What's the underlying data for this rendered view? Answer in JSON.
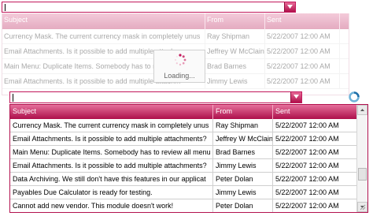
{
  "colors": {
    "accent": "#b3124f",
    "accent_light": "#e56f9b"
  },
  "top_grid": {
    "columns": [
      "Subject",
      "From",
      "Sent"
    ],
    "rows": [
      [
        "Currency Mask. The current currency mask in completely unus",
        "Ray Shipman",
        "5/22/2007 12:00 AM"
      ],
      [
        "Email Attachments. Is it possible to add multiple attachme",
        "Jeffrey W McClain",
        "5/22/2007 12:00 AM"
      ],
      [
        "Main Menu: Duplicate Items. Somebody has to review all",
        "Brad Barnes",
        "5/22/2007 12:00 AM"
      ],
      [
        "Email Attachments. Is it possible to add multiple attachm",
        "Jimmy Lewis",
        "5/22/2007 12:00 AM"
      ]
    ]
  },
  "loading": {
    "text": "Loading..."
  },
  "grid": {
    "columns": [
      "Subject",
      "From",
      "Sent"
    ],
    "rows": [
      [
        "Currency Mask. The current currency mask in completely unus",
        "Ray Shipman",
        "5/22/2007 12:00 AM"
      ],
      [
        "Email Attachments. Is it possible to add multiple attachments?",
        "Jeffrey W McClain",
        "5/22/2007 12:00 AM"
      ],
      [
        "Main Menu: Duplicate Items. Somebody has to review all menu",
        "Brad Barnes",
        "5/22/2007 12:00 AM"
      ],
      [
        "Email Attachments. Is it possible to add multiple attachments?",
        "Jimmy Lewis",
        "5/22/2007 12:00 AM"
      ],
      [
        "Data Archiving. We still don't have this features in our applicat",
        "Peter Dolan",
        "5/22/2007 12:00 AM"
      ],
      [
        "Payables Due Calculator is ready for testing.",
        "Jimmy Lewis",
        "5/22/2007 12:00 AM"
      ],
      [
        "Cannot add new vendor. This module doesn't work!",
        "Peter Dolan",
        "5/22/2007 12:00 AM"
      ]
    ]
  }
}
